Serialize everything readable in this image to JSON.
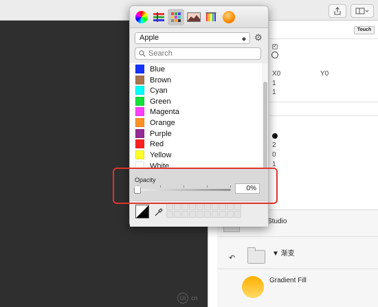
{
  "picker": {
    "tabs": [
      "color-wheel-icon",
      "sliders-icon",
      "palettes-icon",
      "image-palette-icon",
      "pencils-icon",
      "crayons-icon"
    ],
    "palette_name": "Apple",
    "search_placeholder": "Search",
    "colors": [
      {
        "name": "Blue",
        "hex": "#1433ff"
      },
      {
        "name": "Brown",
        "hex": "#a9744f"
      },
      {
        "name": "Cyan",
        "hex": "#00ffff"
      },
      {
        "name": "Green",
        "hex": "#12e23c"
      },
      {
        "name": "Magenta",
        "hex": "#ff40ff"
      },
      {
        "name": "Orange",
        "hex": "#ff9224"
      },
      {
        "name": "Purple",
        "hex": "#952b95"
      },
      {
        "name": "Red",
        "hex": "#ff2020"
      },
      {
        "name": "Yellow",
        "hex": "#ffff2a"
      },
      {
        "name": "White",
        "hex": "#ffffff"
      }
    ],
    "opacity_label": "Opacity",
    "opacity_value": "0%",
    "opacity_fraction": 0
  },
  "toolbar": {
    "touch_label": "Touch"
  },
  "inspector": {
    "x_label": "X0",
    "y_label": "Y0",
    "val_1": "1",
    "val_2": "1",
    "val_3": "2",
    "val_4": "0",
    "val_5": "1"
  },
  "layers": {
    "item1_label": "jami Studio",
    "item2_label": "▼ 渐变",
    "item3_label": "Gradient Fill"
  },
  "watermark": {
    "text": "cn",
    "logo": "Ui"
  },
  "colors": {
    "highlight": "#e0342c"
  }
}
